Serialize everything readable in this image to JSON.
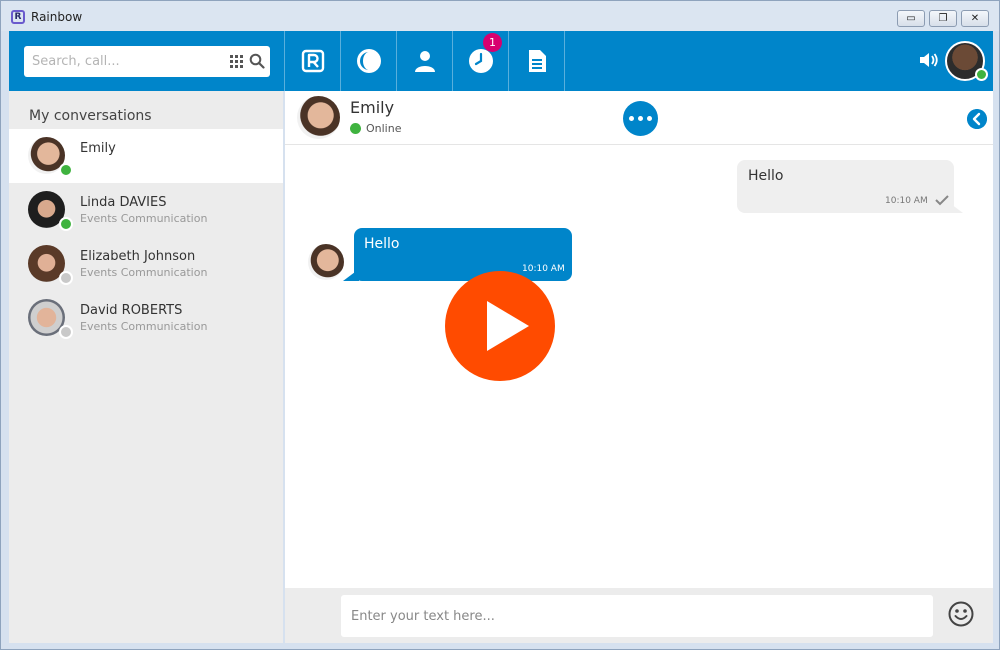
{
  "window": {
    "title": "Rainbow",
    "app_logo": "R",
    "controls": {
      "minimize": "▭",
      "maximize": "❐",
      "close": "✕"
    }
  },
  "topbar": {
    "search": {
      "placeholder": "Search, call...",
      "value": ""
    },
    "nav": [
      {
        "icon": "rainbow-logo-icon"
      },
      {
        "icon": "recent-icon"
      },
      {
        "icon": "contacts-icon"
      },
      {
        "icon": "clock-icon",
        "badge": "1"
      },
      {
        "icon": "document-icon"
      }
    ],
    "accent_color": "#0085ca",
    "badge_color": "#d8006f",
    "user_presence_color": "#3fb33f"
  },
  "sidebar": {
    "title": "My conversations",
    "conversations": [
      {
        "name": "Emily",
        "subtitle": "",
        "presence": "online",
        "active": true
      },
      {
        "name": "Linda DAVIES",
        "subtitle": "Events Communication",
        "presence": "online",
        "active": false
      },
      {
        "name": "Elizabeth Johnson",
        "subtitle": "Events Communication",
        "presence": "offline",
        "active": false
      },
      {
        "name": "David ROBERTS",
        "subtitle": "Events Communication",
        "presence": "offline",
        "active": false
      }
    ]
  },
  "chat": {
    "contact_name": "Emily",
    "contact_status": "Online",
    "messages": [
      {
        "direction": "outgoing",
        "text": "Hello",
        "time": "10:10 AM"
      },
      {
        "direction": "incoming",
        "text": "Hello",
        "time": "10:10 AM"
      }
    ],
    "composer": {
      "placeholder": "Enter your text here...",
      "value": ""
    }
  },
  "overlay": {
    "play_button_color": "#ff4b00"
  }
}
